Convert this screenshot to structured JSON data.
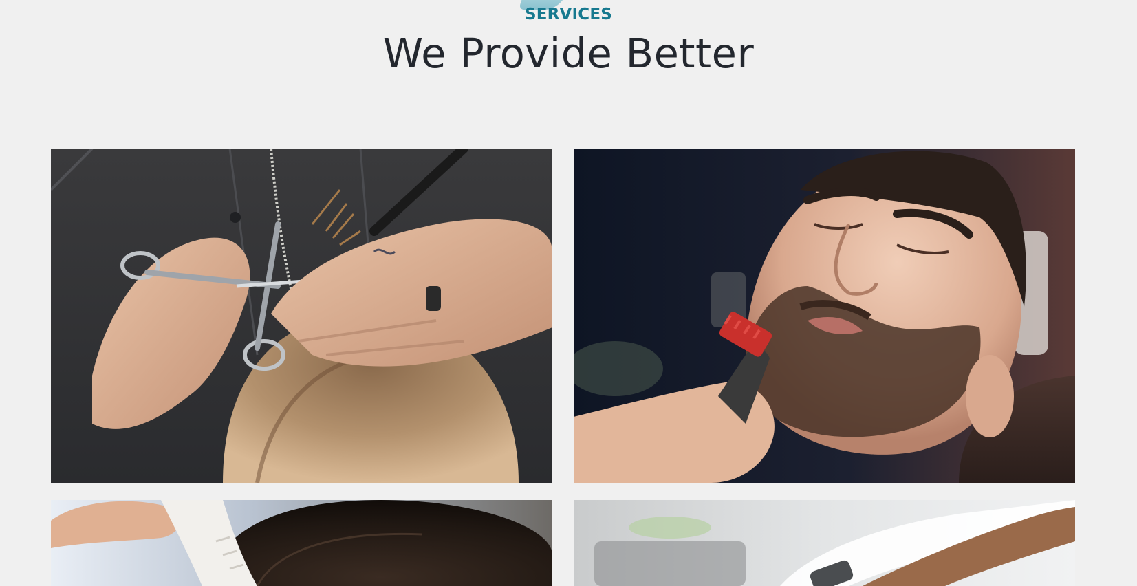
{
  "section": {
    "eyebrow": "SERVICES",
    "title": "We Provide Better"
  },
  "colors": {
    "background": "#f0f0f0",
    "eyebrow_text": "#17798f",
    "eyebrow_shape": "#a6d3dc",
    "title_text": "#23272e"
  },
  "cards": [
    {
      "image": "haircut-scissors-photo"
    },
    {
      "image": "beard-trim-photo"
    },
    {
      "image": "hair-comb-photo"
    },
    {
      "image": "hair-wash-photo"
    }
  ]
}
